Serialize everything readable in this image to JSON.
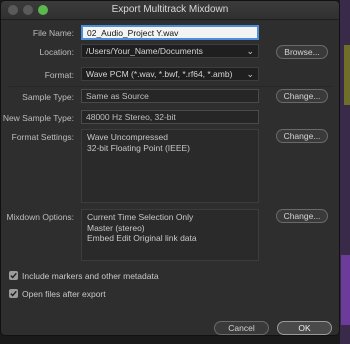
{
  "window": {
    "title": "Export Multitrack Mixdown"
  },
  "labels": {
    "file_name": "File Name:",
    "location": "Location:",
    "format": "Format:",
    "sample_type": "Sample Type:",
    "new_sample_type": "New Sample Type:",
    "format_settings": "Format Settings:",
    "mixdown_options": "Mixdown Options:"
  },
  "file_name": {
    "value": "02_Audio_Project Y.wav"
  },
  "location": {
    "value": "/Users/Your_Name/Documents",
    "browse_label": "Browse..."
  },
  "format": {
    "value": "Wave PCM (*.wav, *.bwf, *.rf64, *.amb)"
  },
  "sample_type": {
    "value": "Same as Source",
    "change_label": "Change..."
  },
  "new_sample_type": {
    "value": "48000 Hz Stereo, 32-bit"
  },
  "format_settings": {
    "lines": [
      "Wave Uncompressed",
      "32-bit Floating Point (IEEE)"
    ],
    "change_label": "Change..."
  },
  "mixdown_options": {
    "lines": [
      "Current Time Selection Only",
      "Master (stereo)",
      "Embed Edit Original link data"
    ],
    "change_label": "Change..."
  },
  "checkboxes": [
    {
      "label": "Include markers and other metadata",
      "checked": true
    },
    {
      "label": "Open files after export",
      "checked": true
    }
  ],
  "buttons": {
    "cancel": "Cancel",
    "ok": "OK"
  },
  "colors": {
    "accent": "#4c8fd8",
    "dialog_bg": "#2e2e2e",
    "zoom_button": "#5ab84d"
  }
}
